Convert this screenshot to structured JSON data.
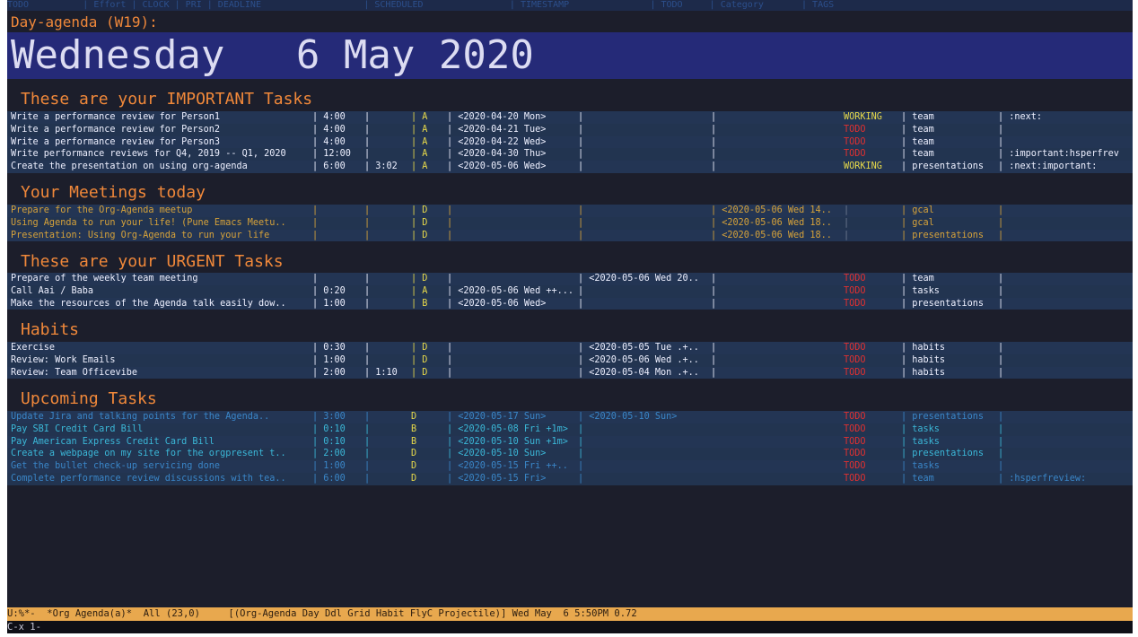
{
  "header_line": "TODO          | Effort | CLOCK | PRI | DEADLINE                   | SCHEDULED                | TIMESTAMP               | TODO     | Category       | TAGS",
  "agenda_title": "Day-agenda (W19):",
  "day": {
    "weekday": "Wednesday",
    "date": "6 May 2020"
  },
  "sections": [
    {
      "title": "These are your IMPORTANT Tasks",
      "rows": [
        {
          "task": "Write a performance review for Person1",
          "effort": "| 4:00",
          "clock": "|",
          "pri": "| A",
          "deadline": "| <2020-04-20 Mon>",
          "scheduled": "|",
          "timestamp": "|",
          "todo": "WORKING",
          "category": "| team",
          "tags": "| :next:",
          "style": "white",
          "todo_style": "yellow"
        },
        {
          "task": "Write a performance review for Person2",
          "effort": "| 4:00",
          "clock": "|",
          "pri": "| A",
          "deadline": "| <2020-04-21 Tue>",
          "scheduled": "|",
          "timestamp": "|",
          "todo": "TODO",
          "category": "| team",
          "tags": "|",
          "style": "white",
          "todo_style": "red"
        },
        {
          "task": "Write a performance review for Person3",
          "effort": "| 4:00",
          "clock": "|",
          "pri": "| A",
          "deadline": "| <2020-04-22 Wed>",
          "scheduled": "|",
          "timestamp": "|",
          "todo": "TODO",
          "category": "| team",
          "tags": "|",
          "style": "white",
          "todo_style": "red"
        },
        {
          "task": "Write performance reviews for Q4, 2019 -- Q1, 2020",
          "effort": "| 12:00",
          "clock": "|",
          "pri": "| A",
          "deadline": "| <2020-04-30 Thu>",
          "scheduled": "|",
          "timestamp": "|",
          "todo": "TODO",
          "category": "| team",
          "tags": "| :important:hsperfrev",
          "style": "white",
          "todo_style": "red"
        },
        {
          "task": "Create the presentation on using org-agenda",
          "effort": "| 6:00",
          "clock": "| 3:02",
          "pri": "| A",
          "deadline": "| <2020-05-06 Wed>",
          "scheduled": "|",
          "timestamp": "|",
          "todo": "WORKING",
          "category": "| presentations",
          "tags": "| :next:important:",
          "style": "white",
          "todo_style": "yellow"
        }
      ]
    },
    {
      "title": "Your Meetings today",
      "rows": [
        {
          "task": "Prepare for the Org-Agenda meetup",
          "effort": "|",
          "clock": "|",
          "pri": "| D",
          "deadline": "|",
          "scheduled": "|",
          "timestamp": "| <2020-05-06 Wed 14..",
          "todo": "|",
          "category": "| gcal",
          "tags": "|",
          "style": "gold",
          "todo_style": "grey"
        },
        {
          "task": "Using Agenda to run your life! (Pune Emacs Meetu..",
          "effort": "|",
          "clock": "|",
          "pri": "| D",
          "deadline": "|",
          "scheduled": "|",
          "timestamp": "| <2020-05-06 Wed 18..",
          "todo": "|",
          "category": "| gcal",
          "tags": "|",
          "style": "gold",
          "todo_style": "grey"
        },
        {
          "task": "Presentation: Using Org-Agenda to run your life",
          "effort": "|",
          "clock": "|",
          "pri": "| D",
          "deadline": "|",
          "scheduled": "|",
          "timestamp": "| <2020-05-06 Wed 18..",
          "todo": "|",
          "category": "| presentations",
          "tags": "|",
          "style": "gold",
          "todo_style": "grey"
        }
      ]
    },
    {
      "title": "These are your URGENT Tasks",
      "rows": [
        {
          "task": "Prepare of the weekly team meeting",
          "effort": "|",
          "clock": "|",
          "pri": "| D",
          "deadline": "|",
          "scheduled": "| <2020-05-06 Wed 20..",
          "timestamp": "|",
          "todo": "TODO",
          "category": "| team",
          "tags": "|",
          "style": "white",
          "todo_style": "red"
        },
        {
          "task": "Call Aai / Baba",
          "effort": "| 0:20",
          "clock": "|",
          "pri": "| A",
          "deadline": "| <2020-05-06 Wed ++...",
          "scheduled": "|",
          "timestamp": "|",
          "todo": "TODO",
          "category": "| tasks",
          "tags": "|",
          "style": "white",
          "todo_style": "red"
        },
        {
          "task": "Make the resources of the Agenda talk easily dow..",
          "effort": "| 1:00",
          "clock": "|",
          "pri": "| B",
          "deadline": "| <2020-05-06 Wed>",
          "scheduled": "|",
          "timestamp": "|",
          "todo": "TODO",
          "category": "| presentations",
          "tags": "|",
          "style": "white",
          "todo_style": "red"
        }
      ]
    },
    {
      "title": "Habits",
      "rows": [
        {
          "task": "Exercise",
          "effort": "| 0:30",
          "clock": "|",
          "pri": "| D",
          "deadline": "|",
          "scheduled": "| <2020-05-05 Tue .+..",
          "timestamp": "|",
          "todo": "TODO",
          "category": "| habits",
          "tags": "|",
          "style": "white",
          "todo_style": "red"
        },
        {
          "task": "Review: Work Emails",
          "effort": "| 1:00",
          "clock": "|",
          "pri": "| D",
          "deadline": "|",
          "scheduled": "| <2020-05-06 Wed .+..",
          "timestamp": "|",
          "todo": "TODO",
          "category": "| habits",
          "tags": "|",
          "style": "white",
          "todo_style": "red"
        },
        {
          "task": "Review: Team Officevibe",
          "effort": "| 2:00",
          "clock": "| 1:10",
          "pri": "| D",
          "deadline": "|",
          "scheduled": "| <2020-05-04 Mon .+..",
          "timestamp": "|",
          "todo": "TODO",
          "category": "| habits",
          "tags": "|",
          "style": "white",
          "todo_style": "red"
        }
      ]
    },
    {
      "title": "Upcoming Tasks",
      "rows": [
        {
          "task": "Update Jira and talking points for the Agenda..",
          "effort": "| 3:00",
          "clock": "|",
          "pri": "D",
          "deadline": "| <2020-05-17 Sun>",
          "scheduled": "| <2020-05-10 Sun>",
          "timestamp": "",
          "todo": "TODO",
          "category": "| presentations",
          "tags": "|",
          "style": "pale",
          "todo_style": "red"
        },
        {
          "task": "Pay SBI Credit Card Bill",
          "effort": "| 0:10",
          "clock": "|",
          "pri": "B",
          "deadline": "| <2020-05-08 Fri +1m>",
          "scheduled": "|",
          "timestamp": "",
          "todo": "TODO",
          "category": "| tasks",
          "tags": "|",
          "style": "teal",
          "todo_style": "red"
        },
        {
          "task": "Pay American Express Credit Card Bill",
          "effort": "| 0:10",
          "clock": "|",
          "pri": "B",
          "deadline": "| <2020-05-10 Sun +1m>",
          "scheduled": "|",
          "timestamp": "",
          "todo": "TODO",
          "category": "| tasks",
          "tags": "|",
          "style": "teal",
          "todo_style": "red"
        },
        {
          "task": "Create a webpage on my site for the orgpresent t..",
          "effort": "| 2:00",
          "clock": "|",
          "pri": "D",
          "deadline": "| <2020-05-10 Sun>",
          "scheduled": "|",
          "timestamp": "",
          "todo": "TODO",
          "category": "| presentations",
          "tags": "|",
          "style": "teal",
          "todo_style": "red"
        },
        {
          "task": "Get the bullet check-up servicing done",
          "effort": "| 1:00",
          "clock": "|",
          "pri": "D",
          "deadline": "| <2020-05-15 Fri ++..",
          "scheduled": "|",
          "timestamp": "",
          "todo": "TODO",
          "category": "| tasks",
          "tags": "|",
          "style": "pale",
          "todo_style": "red"
        },
        {
          "task": "Complete performance review discussions with tea..",
          "effort": "| 6:00",
          "clock": "|",
          "pri": "D",
          "deadline": "| <2020-05-15 Fri>",
          "scheduled": "|",
          "timestamp": "",
          "todo": "TODO",
          "category": "| team",
          "tags": "| :hsperfreview:",
          "style": "pale",
          "todo_style": "red"
        }
      ]
    }
  ],
  "modeline": "U:%*-  *Org Agenda(a)*  All (23,0)     [(Org-Agenda Day Ddl Grid Habit FlyC Projectile)] Wed May  6 5:50PM 0.72",
  "minibuffer": "C-x 1-"
}
